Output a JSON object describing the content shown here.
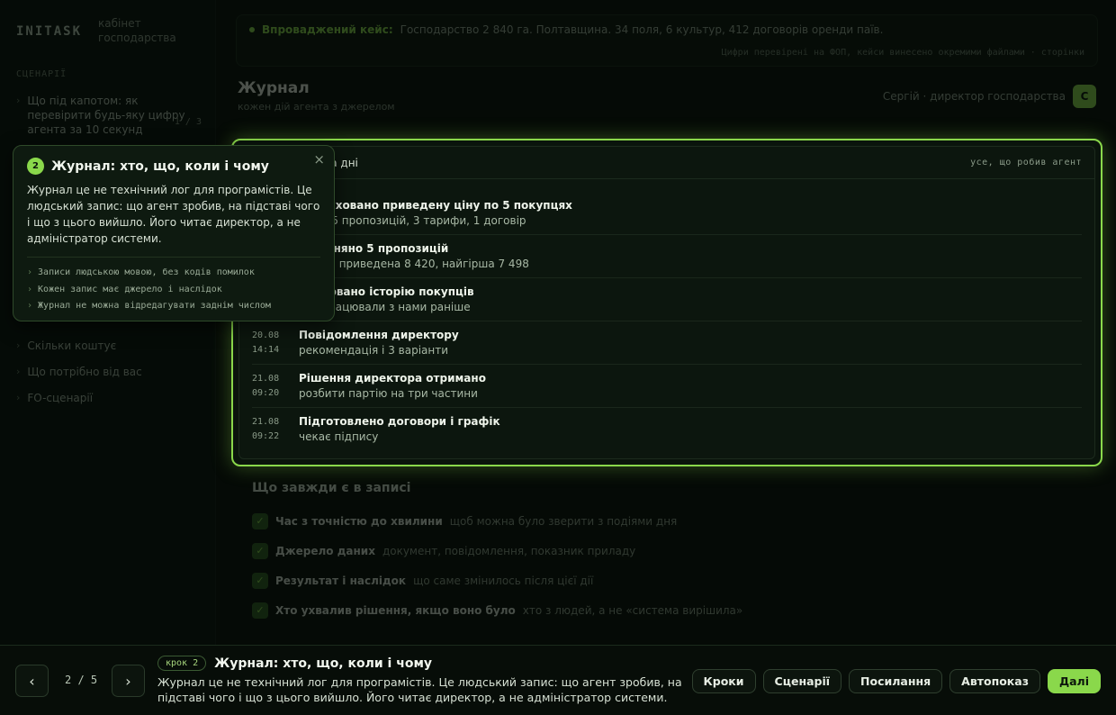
{
  "sidebar": {
    "brand": "INITASK",
    "brand_sub": "кабінет господарства",
    "section": "СЦЕНАРІЇ",
    "question": "Що під капотом: як перевірити будь-яку цифру агента за 10 секунд",
    "question_count": "1 / 3",
    "items": [
      {
        "label": "Скільки коштує"
      },
      {
        "label": "Що потрібно від вас"
      },
      {
        "label": "FO-сценарії"
      }
    ]
  },
  "topbar": {
    "label": "Впроваджений кейс:",
    "text": "Господарство 2 840 га. Полтавщина. 34 поля, 6 культур, 412 договорів оренди паїв.",
    "sub": "Цифри  перевірені  на  ФОП,  кейси  винесено  окремими  файлами  ·  сторінки"
  },
  "page": {
    "title": "Журнал",
    "subtitle": "кожен дій агента з джерелом"
  },
  "user": {
    "name": "Сергій · директор господарства",
    "initial": "С"
  },
  "journal": {
    "header_title": "Журнал за два дні",
    "header_right": "усе, що робив агент",
    "entries": [
      {
        "date": "",
        "time": "",
        "title": "Розраховано приведену ціну по 5 покупцях",
        "sub": "база: 5 пропозицій, 3 тарифи, 1 договір"
      },
      {
        "date": "",
        "time": "",
        "title": "Порівняно 5 пропозицій",
        "sub": "краща приведена 8 420, найгірша 7 498"
      },
      {
        "date": "",
        "time": "",
        "title": "Враховано історію покупців",
        "sub": "хто працювали з нами раніше"
      },
      {
        "date": "20.08",
        "time": "14:14",
        "title": "Повідомлення директору",
        "sub": "рекомендація і 3 варіанти"
      },
      {
        "date": "21.08",
        "time": "09:20",
        "title": "Рішення директора отримано",
        "sub": "розбити партію на три частини"
      },
      {
        "date": "21.08",
        "time": "09:22",
        "title": "Підготовлено договори і графік",
        "sub": "чекає підпису"
      }
    ]
  },
  "always": {
    "title": "Що завжди є в записі",
    "rows": [
      {
        "bold": "Час з точністю до хвилини",
        "desc": "щоб можна було зверити з подіями дня"
      },
      {
        "bold": "Джерело даних",
        "desc": "документ, повідомлення, показник приладу"
      },
      {
        "bold": "Результат і наслідок",
        "desc": "що саме змінилось після цієї дії"
      },
      {
        "bold": "Хто ухвалив рішення, якщо воно було",
        "desc": "хто з людей, а не «система вирішила»"
      }
    ]
  },
  "tooltip": {
    "step": "2",
    "title": "Журнал: хто, що, коли і чому",
    "close": "×",
    "body": "Журнал це не технічний лог для програмістів. Це людський запис: що агент зробив, на підставі чого і що з цього вийшло. Його читає директор, а не адміністратор системи.",
    "bullets": [
      "Записи людською мовою, без кодів помилок",
      "Кожен запис має джерело і наслідок",
      "Журнал не можна відредагувати заднім числом"
    ]
  },
  "bottombar": {
    "prev": "‹",
    "next": "›",
    "counter": "2 / 5",
    "step_pill": "крок 2",
    "title": "Журнал: хто, що, коли і чому",
    "desc": "Журнал це не технічний лог для програмістів. Це людський запис: що агент зробив, на підставі чого і що з цього вийшло. Його читає директор, а не адміністратор системи.",
    "actions": [
      "Кроки",
      "Сценарії",
      "Посилання",
      "Автопоказ"
    ],
    "primary": "Далі"
  },
  "colors": {
    "accent": "#8ad84b",
    "background": "#050a06",
    "panel": "#0c160e"
  }
}
